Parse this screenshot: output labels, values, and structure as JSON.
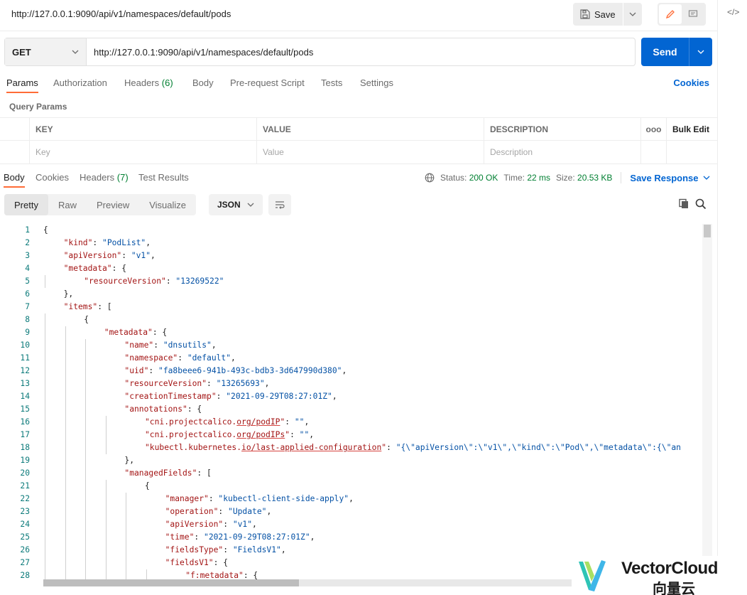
{
  "title_bar": {
    "url": "http://127.0.0.1:9090/api/v1/namespaces/default/pods",
    "save_label": "Save"
  },
  "request": {
    "method": "GET",
    "url": "http://127.0.0.1:9090/api/v1/namespaces/default/pods",
    "send_label": "Send"
  },
  "request_tabs": {
    "params": "Params",
    "authorization": "Authorization",
    "headers": "Headers",
    "headers_count": "(6)",
    "body": "Body",
    "prerequest": "Pre-request Script",
    "tests": "Tests",
    "settings": "Settings",
    "cookies": "Cookies"
  },
  "query_params": {
    "title": "Query Params",
    "headers": {
      "key": "KEY",
      "value": "VALUE",
      "description": "DESCRIPTION",
      "more": "ooo",
      "bulk_edit": "Bulk Edit"
    },
    "placeholders": {
      "key": "Key",
      "value": "Value",
      "description": "Description"
    }
  },
  "response_tabs": {
    "body": "Body",
    "cookies": "Cookies",
    "headers": "Headers",
    "headers_count": "(7)",
    "test_results": "Test Results"
  },
  "response_status": {
    "status_label": "Status:",
    "status_value": "200 OK",
    "time_label": "Time:",
    "time_value": "22 ms",
    "size_label": "Size:",
    "size_value": "20.53 KB",
    "save_response": "Save Response"
  },
  "format_toolbar": {
    "pretty": "Pretty",
    "raw": "Raw",
    "preview": "Preview",
    "visualize": "Visualize",
    "format": "JSON"
  },
  "code_lines": [
    {
      "n": "1",
      "i": 0,
      "parts": [
        [
          "p",
          "{"
        ]
      ]
    },
    {
      "n": "2",
      "i": 1,
      "parts": [
        [
          "k",
          "\"kind\""
        ],
        [
          "p",
          ": "
        ],
        [
          "s",
          "\"PodList\""
        ],
        [
          "p",
          ","
        ]
      ]
    },
    {
      "n": "3",
      "i": 1,
      "parts": [
        [
          "k",
          "\"apiVersion\""
        ],
        [
          "p",
          ": "
        ],
        [
          "s",
          "\"v1\""
        ],
        [
          "p",
          ","
        ]
      ]
    },
    {
      "n": "4",
      "i": 1,
      "parts": [
        [
          "k",
          "\"metadata\""
        ],
        [
          "p",
          ": {"
        ]
      ]
    },
    {
      "n": "5",
      "i": 2,
      "parts": [
        [
          "k",
          "\"resourceVersion\""
        ],
        [
          "p",
          ": "
        ],
        [
          "s",
          "\"13269522\""
        ]
      ]
    },
    {
      "n": "6",
      "i": 1,
      "parts": [
        [
          "p",
          "},"
        ]
      ]
    },
    {
      "n": "7",
      "i": 1,
      "parts": [
        [
          "k",
          "\"items\""
        ],
        [
          "p",
          ": ["
        ]
      ]
    },
    {
      "n": "8",
      "i": 2,
      "parts": [
        [
          "p",
          "{"
        ]
      ]
    },
    {
      "n": "9",
      "i": 3,
      "parts": [
        [
          "k",
          "\"metadata\""
        ],
        [
          "p",
          ": {"
        ]
      ]
    },
    {
      "n": "10",
      "i": 4,
      "parts": [
        [
          "k",
          "\"name\""
        ],
        [
          "p",
          ": "
        ],
        [
          "s",
          "\"dnsutils\""
        ],
        [
          "p",
          ","
        ]
      ]
    },
    {
      "n": "11",
      "i": 4,
      "parts": [
        [
          "k",
          "\"namespace\""
        ],
        [
          "p",
          ": "
        ],
        [
          "s",
          "\"default\""
        ],
        [
          "p",
          ","
        ]
      ]
    },
    {
      "n": "12",
      "i": 4,
      "parts": [
        [
          "k",
          "\"uid\""
        ],
        [
          "p",
          ": "
        ],
        [
          "s",
          "\"fa8beee6-941b-493c-bdb3-3d647990d380\""
        ],
        [
          "p",
          ","
        ]
      ]
    },
    {
      "n": "13",
      "i": 4,
      "parts": [
        [
          "k",
          "\"resourceVersion\""
        ],
        [
          "p",
          ": "
        ],
        [
          "s",
          "\"13265693\""
        ],
        [
          "p",
          ","
        ]
      ]
    },
    {
      "n": "14",
      "i": 4,
      "parts": [
        [
          "k",
          "\"creationTimestamp\""
        ],
        [
          "p",
          ": "
        ],
        [
          "s",
          "\"2021-09-29T08:27:01Z\""
        ],
        [
          "p",
          ","
        ]
      ]
    },
    {
      "n": "15",
      "i": 4,
      "parts": [
        [
          "k",
          "\"annotations\""
        ],
        [
          "p",
          ": {"
        ]
      ]
    },
    {
      "n": "16",
      "i": 5,
      "parts": [
        [
          "k",
          "\"cni.projectcalico."
        ],
        [
          "ku",
          "org/podIP"
        ],
        [
          "k",
          "\""
        ],
        [
          "p",
          ": "
        ],
        [
          "s",
          "\"\""
        ],
        [
          "p",
          ","
        ]
      ]
    },
    {
      "n": "17",
      "i": 5,
      "parts": [
        [
          "k",
          "\"cni.projectcalico."
        ],
        [
          "ku",
          "org/podIPs"
        ],
        [
          "k",
          "\""
        ],
        [
          "p",
          ": "
        ],
        [
          "s",
          "\"\""
        ],
        [
          "p",
          ","
        ]
      ]
    },
    {
      "n": "18",
      "i": 5,
      "parts": [
        [
          "k",
          "\"kubectl.kubernetes."
        ],
        [
          "ku",
          "io/last-applied-configuration"
        ],
        [
          "k",
          "\""
        ],
        [
          "p",
          ": "
        ],
        [
          "s",
          "\"{\\\"apiVersion\\\":\\\"v1\\\",\\\"kind\\\":\\\"Pod\\\",\\\"metadata\\\":{\\\"an"
        ]
      ]
    },
    {
      "n": "19",
      "i": 4,
      "parts": [
        [
          "p",
          "},"
        ]
      ]
    },
    {
      "n": "20",
      "i": 4,
      "parts": [
        [
          "k",
          "\"managedFields\""
        ],
        [
          "p",
          ": ["
        ]
      ]
    },
    {
      "n": "21",
      "i": 5,
      "parts": [
        [
          "p",
          "{"
        ]
      ]
    },
    {
      "n": "22",
      "i": 6,
      "parts": [
        [
          "k",
          "\"manager\""
        ],
        [
          "p",
          ": "
        ],
        [
          "s",
          "\"kubectl-client-side-apply\""
        ],
        [
          "p",
          ","
        ]
      ]
    },
    {
      "n": "23",
      "i": 6,
      "parts": [
        [
          "k",
          "\"operation\""
        ],
        [
          "p",
          ": "
        ],
        [
          "s",
          "\"Update\""
        ],
        [
          "p",
          ","
        ]
      ]
    },
    {
      "n": "24",
      "i": 6,
      "parts": [
        [
          "k",
          "\"apiVersion\""
        ],
        [
          "p",
          ": "
        ],
        [
          "s",
          "\"v1\""
        ],
        [
          "p",
          ","
        ]
      ]
    },
    {
      "n": "25",
      "i": 6,
      "parts": [
        [
          "k",
          "\"time\""
        ],
        [
          "p",
          ": "
        ],
        [
          "s",
          "\"2021-09-29T08:27:01Z\""
        ],
        [
          "p",
          ","
        ]
      ]
    },
    {
      "n": "26",
      "i": 6,
      "parts": [
        [
          "k",
          "\"fieldsType\""
        ],
        [
          "p",
          ": "
        ],
        [
          "s",
          "\"FieldsV1\""
        ],
        [
          "p",
          ","
        ]
      ]
    },
    {
      "n": "27",
      "i": 6,
      "parts": [
        [
          "k",
          "\"fieldsV1\""
        ],
        [
          "p",
          ": {"
        ]
      ]
    },
    {
      "n": "28",
      "i": 7,
      "parts": [
        [
          "k",
          "\"f:metadata\""
        ],
        [
          "p",
          ": {"
        ]
      ]
    }
  ],
  "watermark": {
    "brand": "VectorCloud",
    "brand_cn": "向量云"
  },
  "colors": {
    "accent_orange": "#ff6c37",
    "send_blue": "#0265d2",
    "status_green": "#007f31",
    "json_key": "#a31515",
    "json_string": "#0451a5"
  }
}
